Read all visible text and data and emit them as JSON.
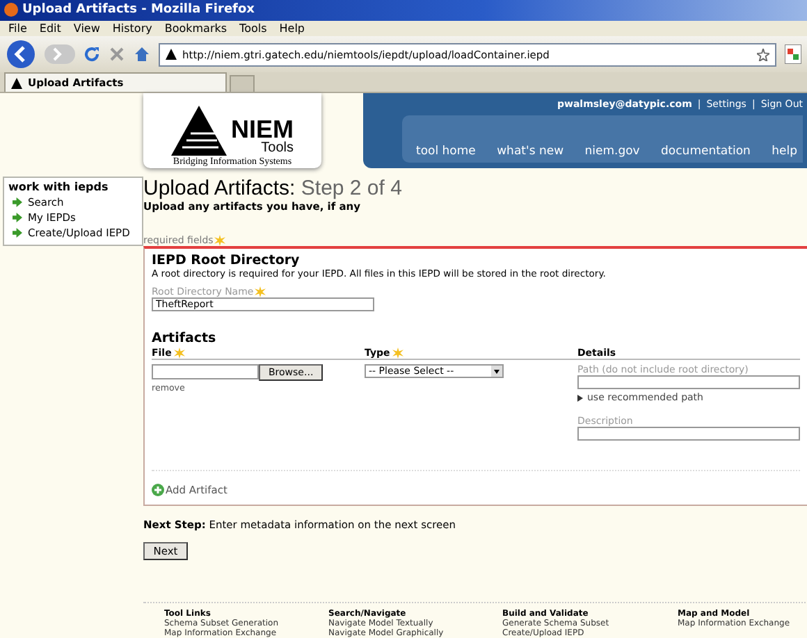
{
  "window": {
    "title": "Upload Artifacts - Mozilla Firefox"
  },
  "menu": [
    "File",
    "Edit",
    "View",
    "History",
    "Bookmarks",
    "Tools",
    "Help"
  ],
  "address": {
    "url": "http://niem.gtri.gatech.edu/niemtools/iepdt/upload/loadContainer.iepd"
  },
  "tabs": [
    {
      "label": "Upload Artifacts",
      "selected": true
    }
  ],
  "logo": {
    "name": "NIEM",
    "sub": "Tools",
    "tagline": "Bridging Information Systems"
  },
  "user_links": [
    {
      "text": "pwalmsley@datypic.com",
      "kind": "user"
    },
    {
      "text": "|",
      "kind": "sep"
    },
    {
      "text": "Settings",
      "kind": "link"
    },
    {
      "text": "|",
      "kind": "sep"
    },
    {
      "text": "Sign Out",
      "kind": "link"
    }
  ],
  "nav": [
    "tool home",
    "what's new",
    "niem.gov",
    "documentation",
    "help"
  ],
  "sidebar": {
    "title": "work with iepds",
    "items": [
      "Search",
      "My IEPDs",
      "Create/Upload IEPD"
    ]
  },
  "page": {
    "title": "Upload Artifacts:",
    "step": "Step 2 of 4",
    "subtitle": "Upload any artifacts you have, if any",
    "required": "required fields"
  },
  "root": {
    "title": "IEPD Root Directory",
    "description": "A root directory is required for your IEPD. All files in this IEPD will be stored in the root directory.",
    "label": "Root Directory Name",
    "value": "TheftReport"
  },
  "artifacts": {
    "title": "Artifacts",
    "columns": [
      {
        "label": "File",
        "required": true
      },
      {
        "label": "Type",
        "required": true
      },
      {
        "label": "Details",
        "required": false
      }
    ],
    "browse": "Browse...",
    "remove": "remove",
    "type_value": "-- Please Select --",
    "path_label": "Path (do not include root directory)",
    "path_link": "use recommended path",
    "description_label": "Description",
    "add": "Add Artifact"
  },
  "next": {
    "label": "Next Step:",
    "text": "Enter metadata information on the next screen",
    "button": "Next"
  },
  "footer": [
    {
      "heading": "Tool Links",
      "links": [
        "Schema Subset Generation",
        "Map Information Exchange"
      ]
    },
    {
      "heading": "Search/Navigate",
      "links": [
        "Navigate Model Textually",
        "Navigate Model Graphically"
      ]
    },
    {
      "heading": "Build and Validate",
      "links": [
        "Generate Schema Subset",
        "Create/Upload IEPD"
      ]
    },
    {
      "heading": "Map and Model",
      "links": [
        "Map Information Exchange"
      ]
    }
  ]
}
